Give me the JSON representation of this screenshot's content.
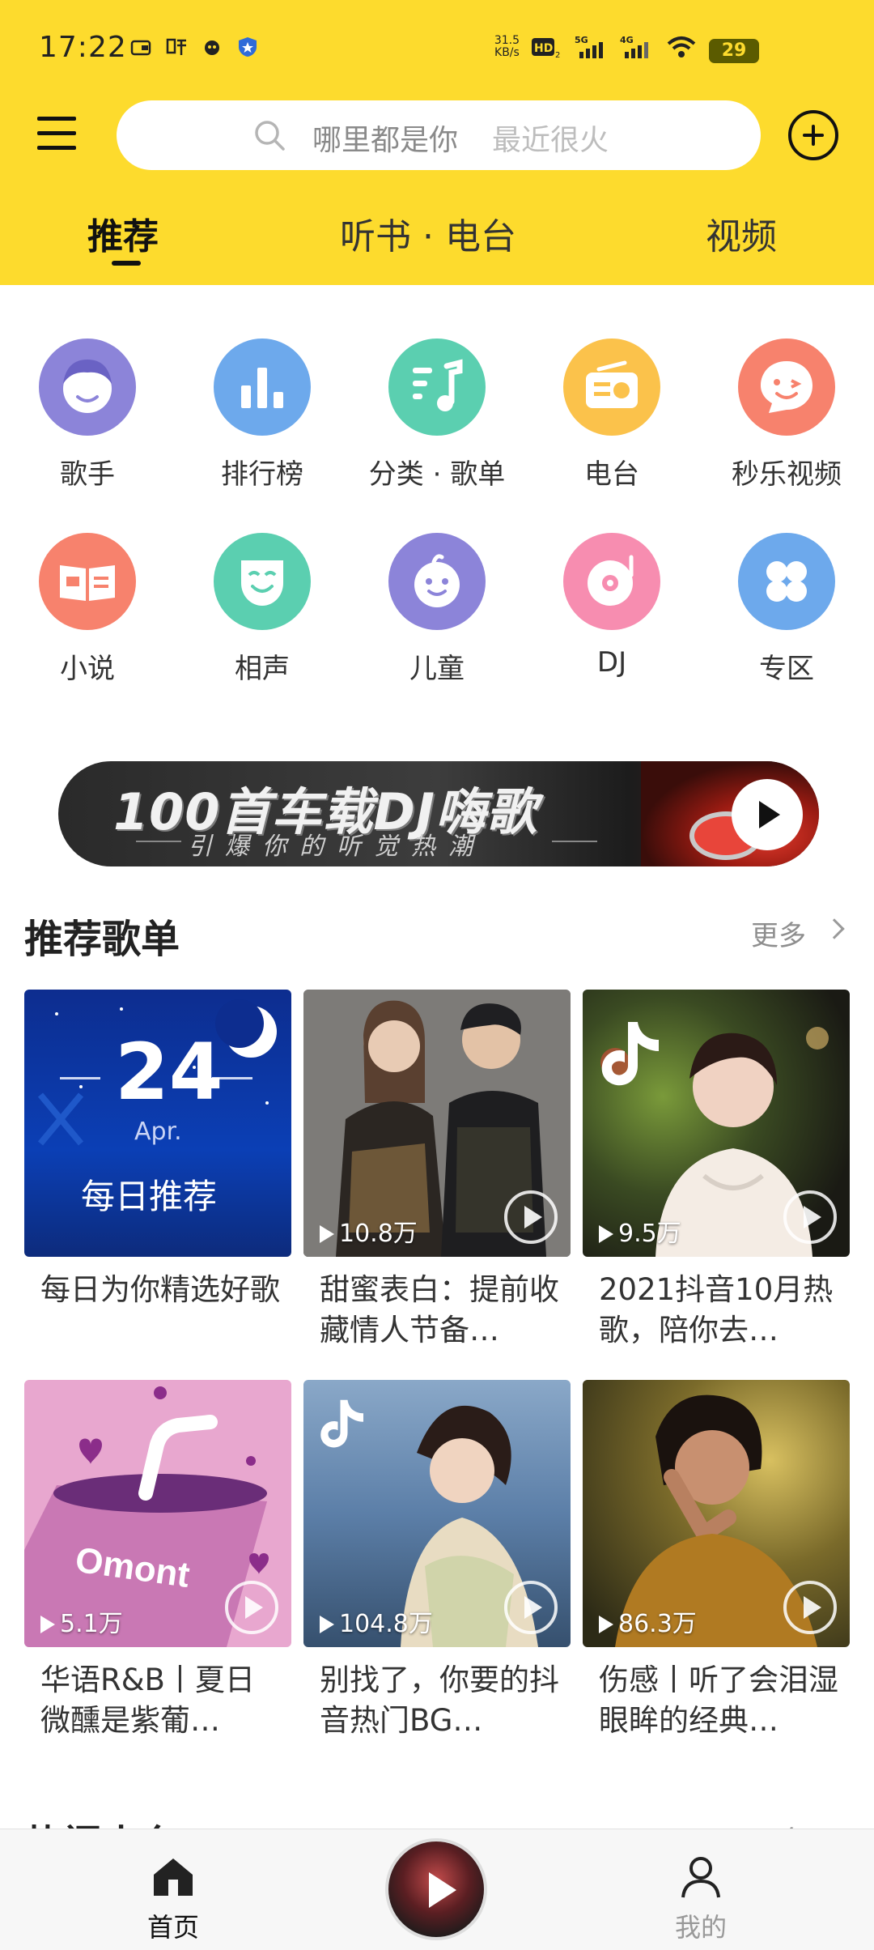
{
  "status_bar": {
    "time": "17:22",
    "net_speed_value": "31.5",
    "net_speed_unit": "KB/s",
    "hd": "HD",
    "sim1": "5G",
    "sim2": "4G",
    "battery": "29"
  },
  "header": {
    "search_hint": "哪里都是你",
    "search_hint_secondary": "最近很火",
    "tabs": [
      {
        "label": "推荐",
        "active": true
      },
      {
        "label": "听书 · 电台",
        "active": false
      },
      {
        "label": "视频",
        "active": false
      }
    ]
  },
  "categories": [
    {
      "label": "歌手",
      "icon": "singer-icon",
      "color": "#8C84D9"
    },
    {
      "label": "排行榜",
      "icon": "chart-icon",
      "color": "#6DA9EC"
    },
    {
      "label": "分类 · 歌单",
      "icon": "playlist-icon",
      "color": "#5BCFB0"
    },
    {
      "label": "电台",
      "icon": "radio-icon",
      "color": "#FBC24B"
    },
    {
      "label": "秒乐视频",
      "icon": "video-icon",
      "color": "#F7826D"
    },
    {
      "label": "小说",
      "icon": "novel-icon",
      "color": "#F7826D"
    },
    {
      "label": "相声",
      "icon": "crosstalk-icon",
      "color": "#5BCFB0"
    },
    {
      "label": "儿童",
      "icon": "children-icon",
      "color": "#8C84D9"
    },
    {
      "label": "DJ",
      "icon": "dj-icon",
      "color": "#F78DB0"
    },
    {
      "label": "专区",
      "icon": "zone-icon",
      "color": "#6DA9EC"
    }
  ],
  "banner": {
    "title": "100首车载DJ嗨歌",
    "subtitle": "引爆你的听觉热潮"
  },
  "recommended": {
    "title": "推荐歌单",
    "more": "更多",
    "daily_day": "24",
    "daily_month": "Apr.",
    "daily_label": "每日推荐",
    "playlists": [
      {
        "title": "每日为你精选好歌",
        "count": ""
      },
      {
        "title": "甜蜜表白：提前收藏情人节备…",
        "count": "10.8万"
      },
      {
        "title": "2021抖音10月热歌，陪你去…",
        "count": "9.5万"
      },
      {
        "title": "华语R&B丨夏日微醺是紫葡…",
        "count": "5.1万"
      },
      {
        "title": "别找了，你要的抖音热门BG…",
        "count": "104.8万"
      },
      {
        "title": "伤感丨听了会泪湿眼眸的经典…",
        "count": "86.3万"
      }
    ]
  },
  "next_section": {
    "title": "热门电台",
    "more": "更多"
  },
  "tab_bar": {
    "home": "首页",
    "me": "我的"
  },
  "colors": {
    "brand_yellow": "#FDDB2D",
    "text_dark": "#222222",
    "text_muted": "#8E8E8E"
  }
}
